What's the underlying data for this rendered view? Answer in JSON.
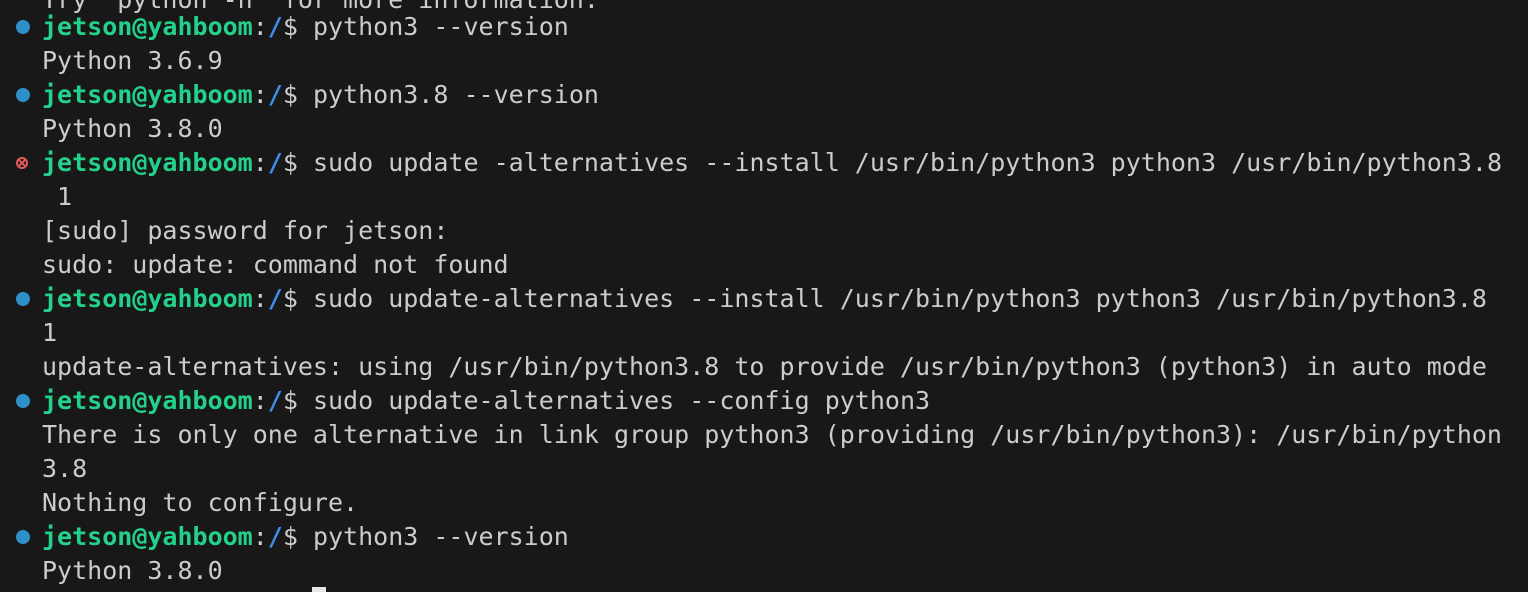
{
  "terminal": {
    "prompt": {
      "user_host": "jetson@yahboom",
      "sep": ":",
      "path": "/",
      "symbol": "$ "
    },
    "lines": {
      "l0": "Try `python -h' for more information.",
      "c1": "python3 --version",
      "o1": "Python 3.6.9",
      "c2": "python3.8 --version",
      "o2": "Python 3.8.0",
      "c3": "sudo update -alternatives --install /usr/bin/python3 python3 /usr/bin/python3.8",
      "c3b": " 1",
      "o3a": "[sudo] password for jetson:",
      "o3b": "sudo: update: command not found",
      "c4": "sudo update-alternatives --install /usr/bin/python3 python3 /usr/bin/python3.8",
      "c4b": "1",
      "o4": "update-alternatives: using /usr/bin/python3.8 to provide /usr/bin/python3 (python3) in auto mode",
      "c5": "sudo update-alternatives --config python3",
      "o5a": "There is only one alternative in link group python3 (providing /usr/bin/python3): /usr/bin/python",
      "o5b": "3.8",
      "o5c": "Nothing to configure.",
      "c6": "python3 --version",
      "o6": "Python 3.8.0"
    },
    "decorations": {
      "success_icon": "circle-filled-icon",
      "error_icon": "circle-x-icon"
    },
    "colors": {
      "background": "#181818",
      "text": "#cccccc",
      "user": "#23d18b",
      "path": "#3b8eea",
      "success": "#2f8fc9",
      "error": "#e25a5a"
    }
  }
}
